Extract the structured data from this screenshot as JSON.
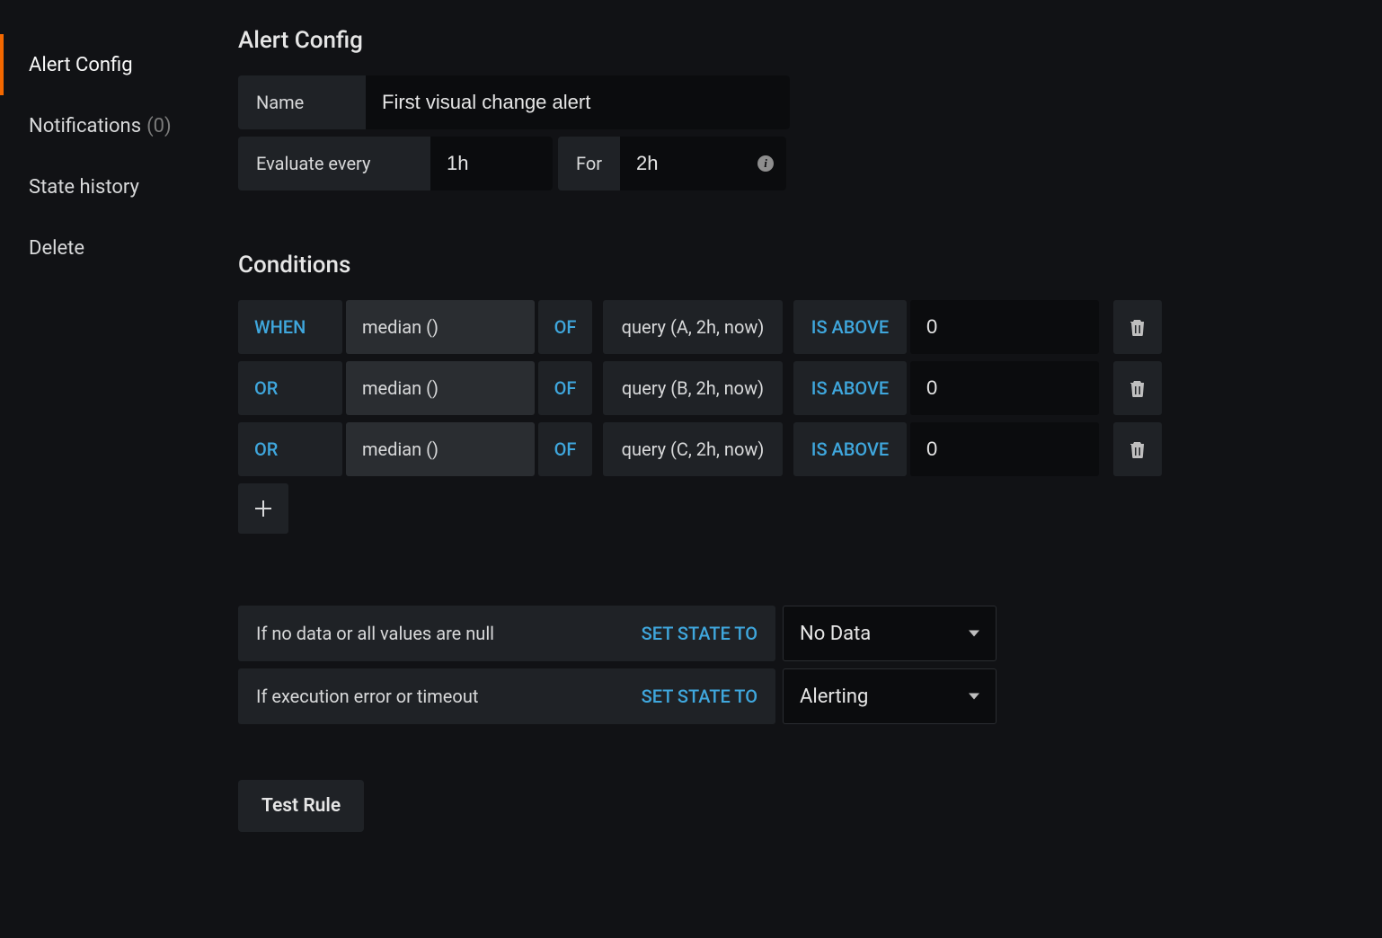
{
  "sidebar": {
    "items": [
      {
        "label": "Alert Config",
        "active": true
      },
      {
        "label": "Notifications",
        "count": "(0)",
        "active": false
      },
      {
        "label": "State history",
        "active": false
      },
      {
        "label": "Delete",
        "active": false
      }
    ]
  },
  "page_title": "Alert Config",
  "name_field": {
    "label": "Name",
    "value": "First visual change alert"
  },
  "evaluate": {
    "label": "Evaluate every",
    "value": "1h"
  },
  "for": {
    "label": "For",
    "value": "2h"
  },
  "conditions_title": "Conditions",
  "keywords": {
    "of": "OF",
    "is_above": "IS ABOVE"
  },
  "conditions": [
    {
      "operator": "WHEN",
      "aggr": "median ()",
      "query": "query (A, 2h, now)",
      "threshold": "0"
    },
    {
      "operator": "OR",
      "aggr": "median ()",
      "query": "query (B, 2h, now)",
      "threshold": "0"
    },
    {
      "operator": "OR",
      "aggr": "median ()",
      "query": "query (C, 2h, now)",
      "threshold": "0"
    }
  ],
  "no_data": {
    "label": "If no data or all values are null",
    "setto": "SET STATE TO",
    "value": "No Data"
  },
  "exec_error": {
    "label": "If execution error or timeout",
    "setto": "SET STATE TO",
    "value": "Alerting"
  },
  "test_rule": "Test Rule"
}
